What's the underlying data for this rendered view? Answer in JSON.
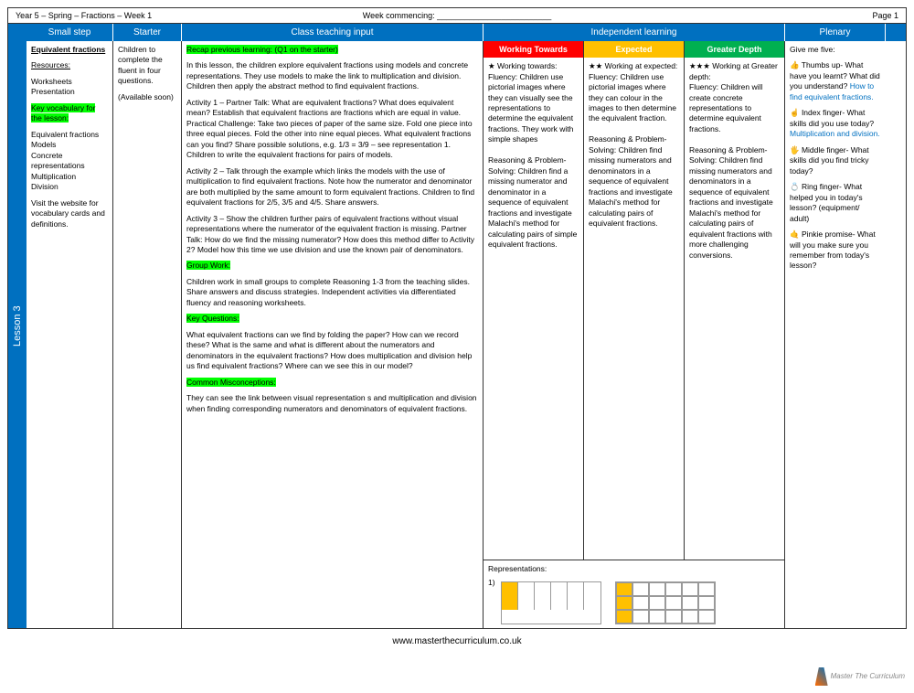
{
  "topbar": {
    "left": "Year 5 – Spring – Fractions – Week 1",
    "center": "Week commencing: _________________________",
    "right": "Page 1"
  },
  "lesson_tab": "Lesson 3",
  "headers": {
    "step": "Small step",
    "starter": "Starter",
    "input": "Class teaching input",
    "independent": "Independent learning",
    "plenary": "Plenary"
  },
  "step": {
    "title": "Equivalent fractions",
    "resources_label": "Resources:",
    "resources": "Worksheets\nPresentation",
    "vocab_label": "Key vocabulary for the lesson:",
    "vocab": "Equivalent fractions\nModels\nConcrete representations\nMultiplication\nDivision",
    "note": "Visit the website for vocabulary cards and definitions."
  },
  "starter": {
    "text": "Children to complete the fluent in four questions.",
    "note": "(Available soon)"
  },
  "input": {
    "recap_label": "Recap previous learning: (Q1 on the starter)",
    "intro": "In this lesson, the children explore equivalent fractions using models and concrete representations. They use models to make the link to multiplication and division. Children then apply the abstract method to find equivalent fractions.",
    "activity1": "Activity 1 – Partner Talk: What are equivalent fractions? What does equivalent mean? Establish that equivalent fractions are fractions which are equal in value. Practical Challenge: Take two pieces of paper of the same size. Fold one piece into three equal pieces. Fold the other into nine equal pieces. What equivalent fractions can you find? Share possible solutions, e.g. 1/3 = 3/9 – see representation 1. Children to write the equivalent fractions for pairs of models.",
    "activity2": "Activity 2 – Talk through the example which links the models with the use of multiplication to find equivalent fractions. Note how the numerator and denominator are both multiplied by the same amount to form equivalent fractions. Children to find equivalent fractions for 2/5, 3/5 and 4/5. Share answers.",
    "activity3": "Activity 3 – Show the children further pairs of equivalent fractions without visual representations where the numerator of the equivalent fraction is missing. Partner Talk: How do we find the missing numerator? How does this method differ to Activity 2? Model how this time we use division and use the known pair of denominators.",
    "group_label": "Group Work:",
    "group": "Children work in small groups to complete Reasoning 1-3 from the teaching slides. Share answers and discuss strategies. Independent activities via differentiated fluency and reasoning worksheets.",
    "questions_label": "Key Questions:",
    "questions": "What equivalent fractions can we find by folding the paper? How can we record these? What is the same and what is different about the numerators and denominators in the equivalent fractions? How does multiplication and division help us find equivalent fractions? Where can we see this in our model?",
    "misconceptions_label": "Common Misconceptions:",
    "misconceptions": "They can see the link between visual representation s and multiplication and division when finding corresponding numerators and denominators of equivalent fractions."
  },
  "diff": {
    "wt_label": "Working Towards",
    "exp_label": "Expected",
    "gd_label": "Greater Depth",
    "wt": "★ Working towards:\nFluency: Children use pictorial images where they can visually see the representations to determine the equivalent fractions. They work with simple shapes\n\nReasoning & Problem-Solving: Children find a missing numerator and denominator in a sequence of equivalent fractions and investigate Malachi's method for calculating pairs of simple equivalent fractions.",
    "exp": "★★ Working at expected:\nFluency: Children use pictorial images where they can colour in the images to then determine the equivalent fraction.\n\nReasoning & Problem-Solving: Children find missing numerators and denominators in a sequence of equivalent fractions and investigate Malachi's method for calculating pairs of equivalent fractions.",
    "gd": "★★★ Working at Greater depth:\nFluency: Children will create concrete representations to determine equivalent fractions.\n\nReasoning & Problem-Solving: Children find missing numerators and denominators in a sequence of equivalent fractions and investigate Malachi's method for calculating pairs of equivalent fractions with more challenging conversions."
  },
  "representations_label": "Representations:",
  "rep_num": "1)",
  "plenary": {
    "intro": "Give me five:",
    "thumb": "👍 Thumbs up- What have you learnt? What did you understand?",
    "thumb_ans": "How to find equivalent fractions.",
    "index": "☝ Index finger- What skills did you use today?",
    "index_ans": "Multiplication and division.",
    "middle": "🖐 Middle finger- What skills did you find tricky today?",
    "ring": "💍 Ring finger- What helped you in today's lesson? (equipment/ adult)",
    "pinkie": "🤙 Pinkie promise- What will you make sure you remember from today's lesson?"
  },
  "footer": "www.masterthecurriculum.co.uk",
  "logo_text": "Master The Curriculum"
}
